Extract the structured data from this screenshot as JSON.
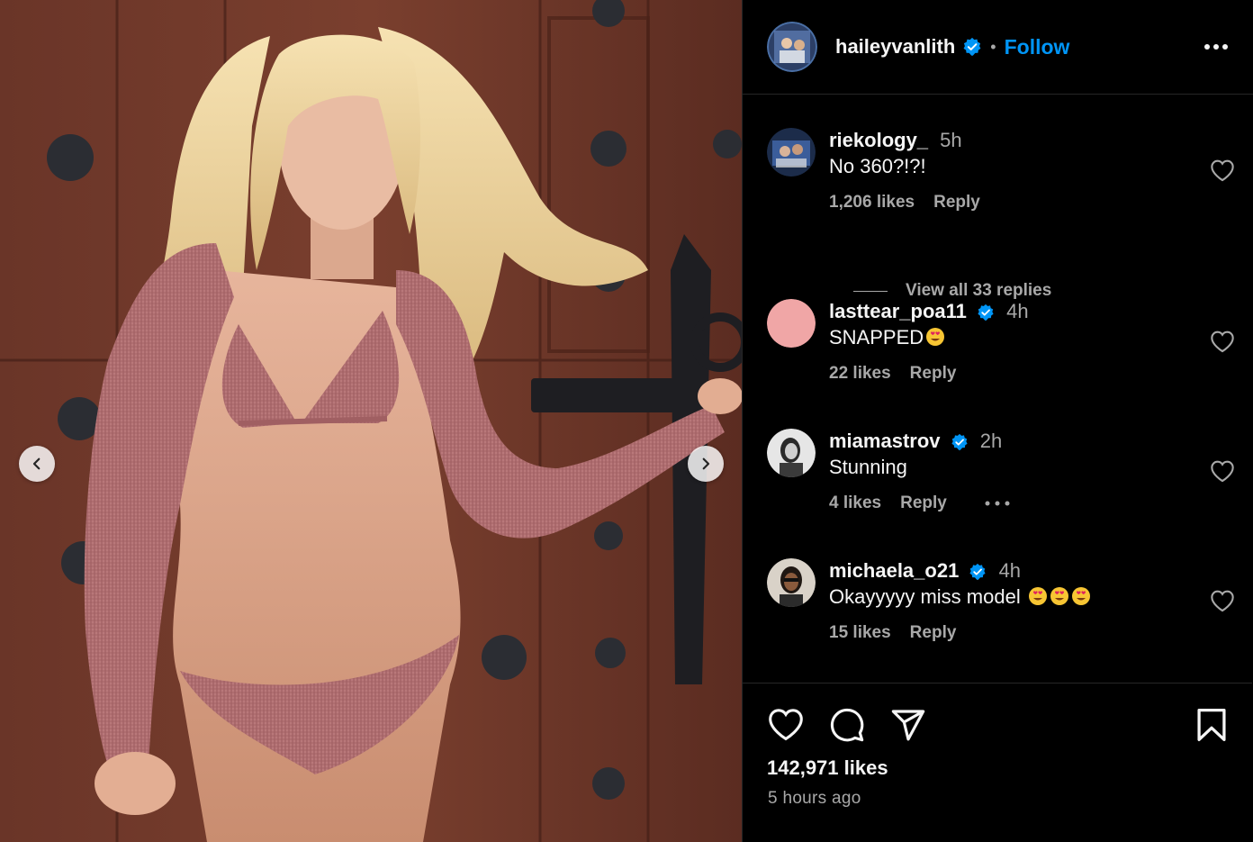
{
  "post": {
    "author": {
      "username": "haileyvanlith",
      "verified": true,
      "follow_label": "Follow",
      "separator": "•"
    },
    "media": {
      "alt": "Photo of a woman in a gingham bikini and sleeves posing against a wooden door",
      "prev_icon": "chevron-left-icon",
      "next_icon": "chevron-right-icon"
    },
    "comments": [
      {
        "username": "riekology_",
        "verified": false,
        "time": "5h",
        "text": "No 360?!?!",
        "emojis": 0,
        "likes": "1,206 likes",
        "reply_label": "Reply",
        "view_replies": "View all 33 replies"
      },
      {
        "username": "lasttear_poa11",
        "verified": true,
        "time": "4h",
        "text": "SNAPPED",
        "emojis": 1,
        "likes": "22 likes",
        "reply_label": "Reply"
      },
      {
        "username": "miamastrov",
        "verified": true,
        "time": "2h",
        "text": "Stunning",
        "emojis": 0,
        "likes": "4 likes",
        "reply_label": "Reply",
        "has_more": true
      },
      {
        "username": "michaela_o21",
        "verified": true,
        "time": "4h",
        "text": "Okayyyyy miss model ",
        "emojis": 3,
        "likes": "15 likes",
        "reply_label": "Reply"
      }
    ],
    "footer": {
      "likes": "142,971 likes",
      "time_ago": "5 hours ago",
      "icons": [
        "heart-icon",
        "comment-icon",
        "share-icon",
        "bookmark-icon"
      ]
    },
    "colors": {
      "background": "#000000",
      "text": "#f5f5f5",
      "secondary_text": "#a8a8a8",
      "link_blue": "#0095f6",
      "divider": "#262626",
      "verified_blue": "#0095f6"
    }
  }
}
